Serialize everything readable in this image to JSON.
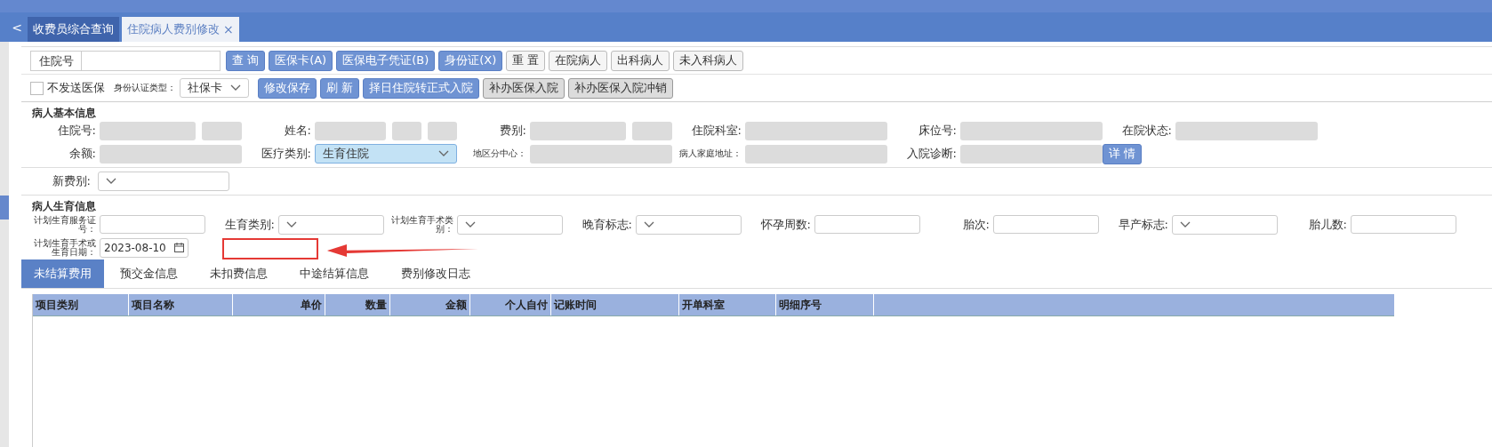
{
  "nav_tabs": [
    {
      "label": "收费员综合查询",
      "selected": false,
      "closable": false
    },
    {
      "label": "住院病人费别修改",
      "selected": true,
      "closable": true
    }
  ],
  "collapse_button": "<",
  "close_glyph": "×",
  "toolbar1": {
    "search": {
      "label": "住院号"
    },
    "buttons": [
      {
        "label": "查 询",
        "kind": "primary"
      },
      {
        "label": "医保卡(A)",
        "kind": "primary"
      },
      {
        "label": "医保电子凭证(B)",
        "kind": "primary"
      },
      {
        "label": "身份证(X)",
        "kind": "primary"
      },
      {
        "label": "重 置",
        "kind": "default"
      },
      {
        "label": "在院病人",
        "kind": "default"
      },
      {
        "label": "出科病人",
        "kind": "default"
      },
      {
        "label": "未入科病人",
        "kind": "default"
      }
    ]
  },
  "toolbar2": {
    "checkbox": {
      "label": "不发送医保",
      "checked": false
    },
    "id_type": {
      "label": "身份认证类型：",
      "value": "社保卡"
    },
    "buttons": [
      {
        "label": "修改保存",
        "kind": "primary"
      },
      {
        "label": "刷 新",
        "kind": "primary"
      },
      {
        "label": "择日住院转正式入院",
        "kind": "primary"
      },
      {
        "label": "补办医保入院",
        "kind": "muted"
      },
      {
        "label": "补办医保入院冲销",
        "kind": "muted"
      }
    ]
  },
  "basic_info": {
    "title": "病人基本信息",
    "fields": [
      {
        "label": "住院号:",
        "kind": "readonly"
      },
      {
        "label": "姓名:",
        "kind": "readonly"
      },
      {
        "label": "费别:",
        "kind": "readonly"
      },
      {
        "label": "住院科室:",
        "kind": "readonly"
      },
      {
        "label": "床位号:",
        "kind": "readonly"
      },
      {
        "label": "在院状态:",
        "kind": "readonly"
      },
      {
        "label": "余额:",
        "kind": "readonly"
      },
      {
        "label": "医疗类别:",
        "kind": "select",
        "value": "生育住院",
        "highlighted": true
      },
      {
        "label": "地区分中心：",
        "kind": "readonly"
      },
      {
        "label": "病人家庭地址：",
        "kind": "readonly"
      },
      {
        "label": "入院诊断:",
        "kind": "readonly"
      },
      {
        "label": "详 情",
        "kind": "button"
      }
    ]
  },
  "new_fee": {
    "label": "新费别:"
  },
  "birth_info": {
    "title": "病人生育信息",
    "fields": [
      {
        "label": "计划生育服务证号：",
        "kind": "input"
      },
      {
        "label": "生育类别:",
        "kind": "select"
      },
      {
        "label": "计划生育手术类别：",
        "kind": "select"
      },
      {
        "label": "晚育标志:",
        "kind": "select"
      },
      {
        "label": "怀孕周数:",
        "kind": "input"
      },
      {
        "label": "胎次:",
        "kind": "input"
      },
      {
        "label": "早产标志:",
        "kind": "select"
      },
      {
        "label": "胎儿数:",
        "kind": "input"
      },
      {
        "label": "计划生育手术或生育日期：",
        "kind": "date",
        "value": "2023-08-10"
      }
    ]
  },
  "detail_tabs": [
    {
      "label": "未结算费用",
      "selected": true
    },
    {
      "label": "预交金信息",
      "selected": false
    },
    {
      "label": "未扣费信息",
      "selected": false
    },
    {
      "label": "中途结算信息",
      "selected": false
    },
    {
      "label": "费别修改日志",
      "selected": false
    }
  ],
  "table": {
    "columns": [
      {
        "label": "项目类别"
      },
      {
        "label": "项目名称"
      },
      {
        "label": "单价"
      },
      {
        "label": "数量"
      },
      {
        "label": "金额"
      },
      {
        "label": "个人自付"
      },
      {
        "label": "记账时间"
      },
      {
        "label": "开单科室"
      },
      {
        "label": "明细序号"
      }
    ]
  }
}
